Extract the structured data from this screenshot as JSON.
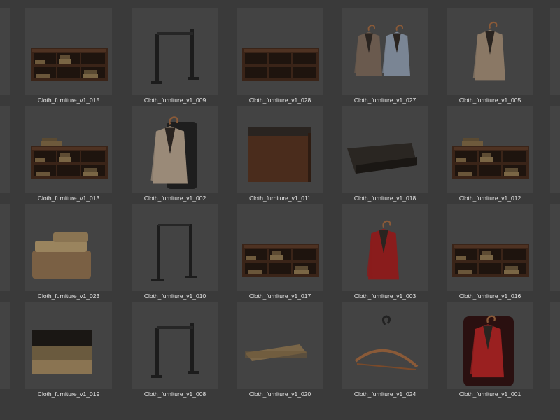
{
  "assets": [
    {
      "name": "Cloth_furniture_v1_015",
      "icon": "shelf-books-icon"
    },
    {
      "name": "Cloth_furniture_v1_009",
      "icon": "rack-stand-icon"
    },
    {
      "name": "Cloth_furniture_v1_028",
      "icon": "shelf-empty-icon"
    },
    {
      "name": "Cloth_furniture_v1_027",
      "icon": "suits-pair-icon"
    },
    {
      "name": "Cloth_furniture_v1_005",
      "icon": "jacket-hanger-icon"
    },
    {
      "name": "Cloth_furniture_v1_013",
      "icon": "shelf-stacked-icon"
    },
    {
      "name": "Cloth_furniture_v1_002",
      "icon": "jackets-cover-icon"
    },
    {
      "name": "Cloth_furniture_v1_011",
      "icon": "cabinet-box-icon"
    },
    {
      "name": "Cloth_furniture_v1_018",
      "icon": "ottoman-icon"
    },
    {
      "name": "Cloth_furniture_v1_012",
      "icon": "shelf-stacked-icon"
    },
    {
      "name": "Cloth_furniture_v1_023",
      "icon": "folded-clothes-icon"
    },
    {
      "name": "Cloth_furniture_v1_010",
      "icon": "rack-frame-icon"
    },
    {
      "name": "Cloth_furniture_v1_017",
      "icon": "shelf-books-icon"
    },
    {
      "name": "Cloth_furniture_v1_003",
      "icon": "red-jacket-icon"
    },
    {
      "name": "Cloth_furniture_v1_016",
      "icon": "shelf-books-icon"
    },
    {
      "name": "Cloth_furniture_v1_019",
      "icon": "folded-stack-icon"
    },
    {
      "name": "Cloth_furniture_v1_008",
      "icon": "rack-stand-icon"
    },
    {
      "name": "Cloth_furniture_v1_020",
      "icon": "folded-flat-icon"
    },
    {
      "name": "Cloth_furniture_v1_024",
      "icon": "hanger-icon"
    },
    {
      "name": "Cloth_furniture_v1_001",
      "icon": "red-jacket-cover-icon"
    }
  ]
}
